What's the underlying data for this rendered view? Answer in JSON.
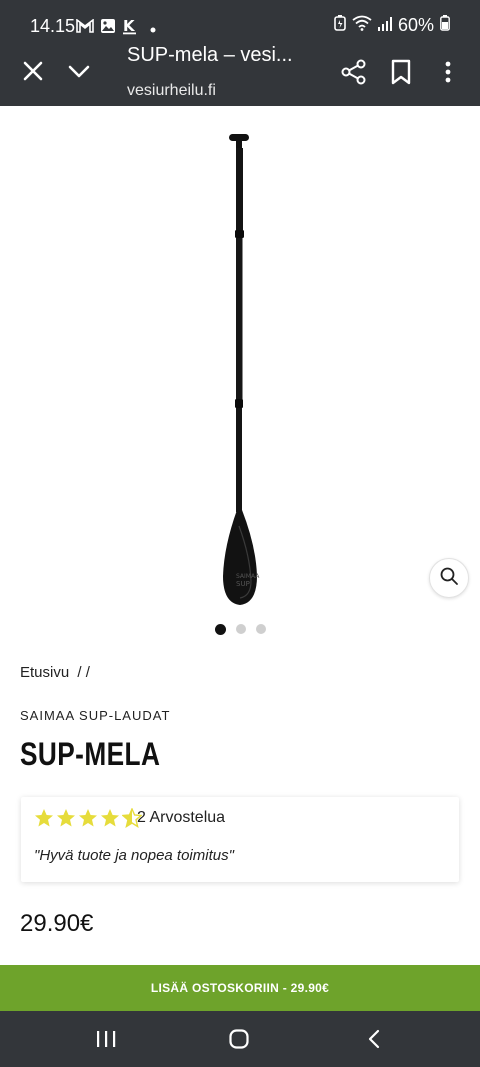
{
  "status_bar": {
    "time": "14.15",
    "battery": "60%",
    "icons": [
      "gmail-icon",
      "gallery-icon",
      "k-app-icon",
      "dot-icon",
      "battery-saver-icon",
      "wifi-icon",
      "signal-icon",
      "battery-icon"
    ]
  },
  "browser": {
    "page_title": "SUP-mela – vesi...",
    "domain": "vesiurheilu.fi",
    "icons": [
      "close-icon",
      "chevron-down-icon",
      "share-icon",
      "bookmark-icon",
      "more-icon"
    ]
  },
  "gallery": {
    "image_alt": "SUP-mela",
    "dots_total": 3,
    "dots_active": 1,
    "zoom_icon": "zoom-icon"
  },
  "breadcrumb": {
    "home": "Etusivu",
    "separators": "/ /"
  },
  "product": {
    "brand": "SAIMAA SUP-LAUDAT",
    "title": "SUP-MELA",
    "rating": 4.5,
    "rating_max": 5,
    "review_count_text": "2 Arvostelua",
    "review_quote": "\"Hyvä tuote ja nopea toimitus\"",
    "price": "29.90€"
  },
  "cta": {
    "label": "LISÄÄ OSTOSKORIIN  - 29.90€"
  },
  "colors": {
    "bar_bg": "#33363a",
    "accent_green": "#6ea32b",
    "star_yellow": "#e6dc3b"
  },
  "nav": {
    "icons": [
      "recent-apps-icon",
      "home-icon",
      "back-icon"
    ]
  }
}
